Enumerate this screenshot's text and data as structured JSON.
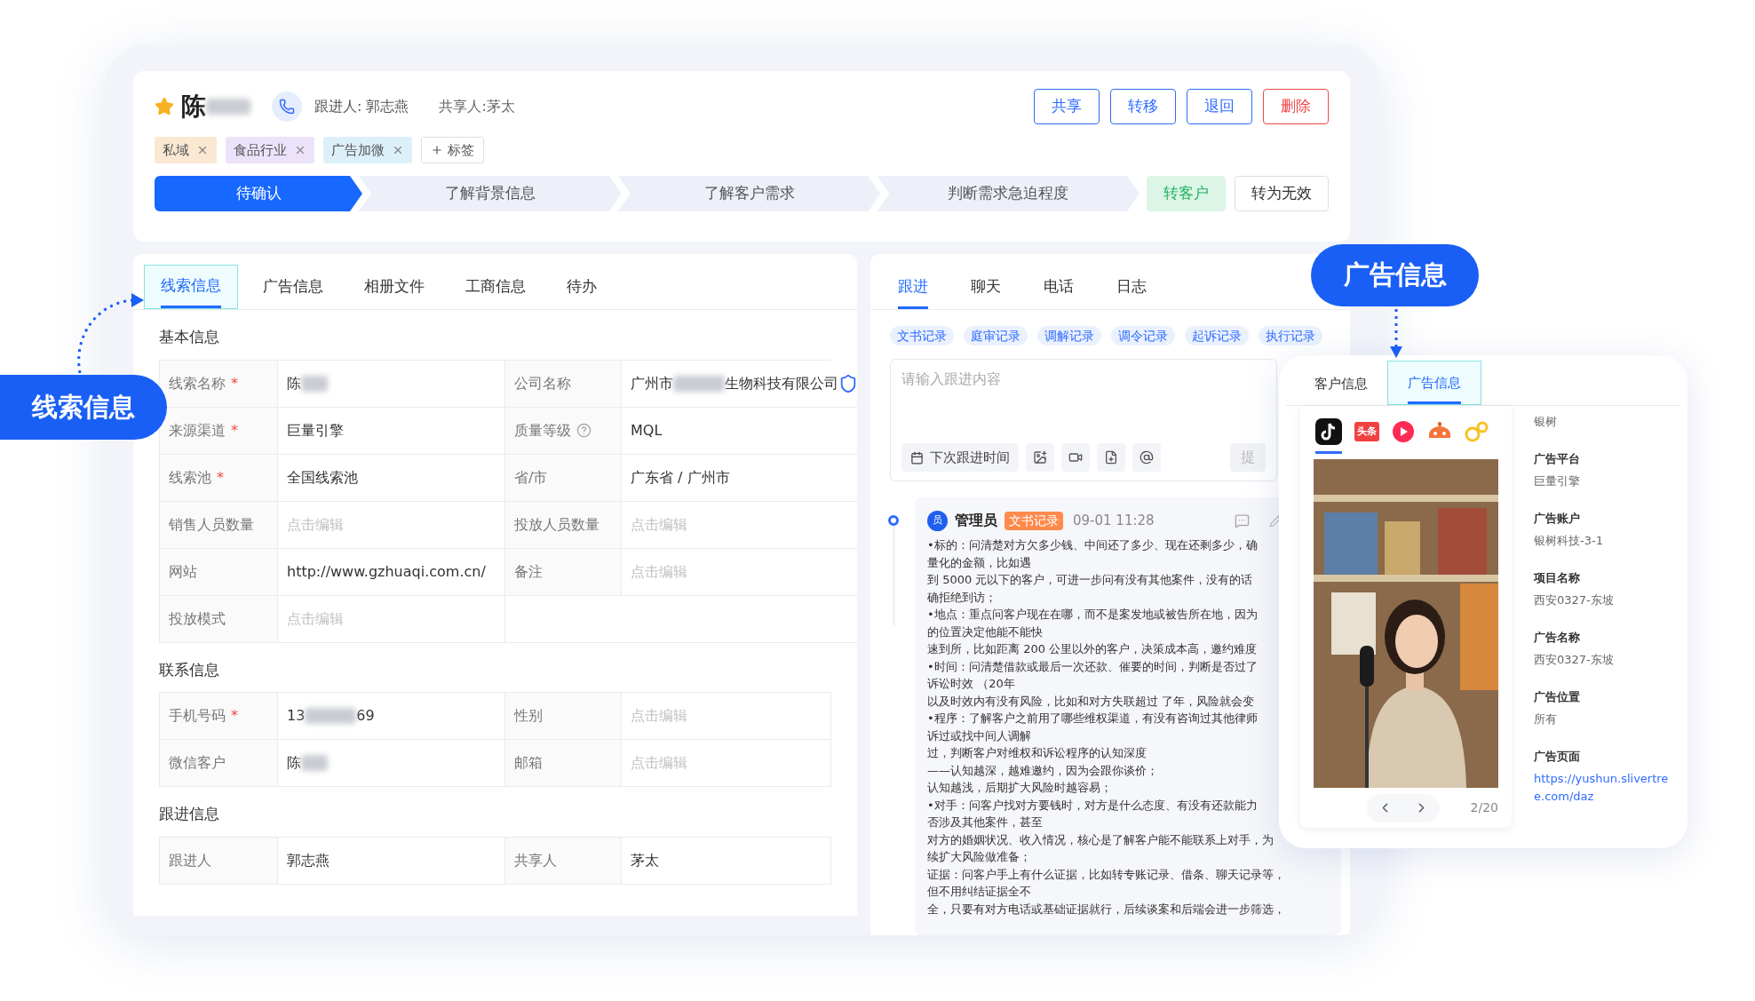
{
  "header": {
    "starred": true,
    "name": "陈",
    "name_redacted": true,
    "follower": "跟进人: 郭志燕",
    "sharer": "共享人:茅太",
    "actions": [
      {
        "label": "共享",
        "kind": "primary"
      },
      {
        "label": "转移",
        "kind": "primary"
      },
      {
        "label": "退回",
        "kind": "primary"
      },
      {
        "label": "删除",
        "kind": "danger"
      }
    ],
    "tags": [
      {
        "label": "私域",
        "color": "#fbe8d3"
      },
      {
        "label": "食品行业",
        "color": "#ece3fb"
      },
      {
        "label": "广告加微",
        "color": "#dcf0fa"
      }
    ],
    "add_tag": "标签",
    "stages": [
      {
        "label": "待确认",
        "selected": true
      },
      {
        "label": "了解背景信息",
        "selected": false
      },
      {
        "label": "了解客户需求",
        "selected": false
      },
      {
        "label": "判断需求急迫程度",
        "selected": false
      }
    ],
    "stage_actions": [
      {
        "label": "转客户",
        "kind": "success"
      },
      {
        "label": "转为无效",
        "kind": "plain"
      }
    ]
  },
  "lead_panel": {
    "tabs": [
      {
        "label": "线索信息",
        "selected": true
      },
      {
        "label": "广告信息",
        "selected": false
      },
      {
        "label": "相册文件",
        "selected": false
      },
      {
        "label": "工商信息",
        "selected": false
      },
      {
        "label": "待办",
        "selected": false
      }
    ],
    "sections": [
      {
        "title": "基本信息",
        "rows": [
          [
            {
              "label": "线索名称",
              "mark": "*",
              "value_parts": [
                "陈"
              ],
              "redacted": true
            },
            {
              "label": "公司名称",
              "value_parts": [
                "广州市",
                "生物科技有限公司"
              ],
              "redacted": true,
              "verified": true
            }
          ],
          [
            {
              "label": "来源渠道",
              "mark": "*",
              "value_parts": [
                "巨量引擎"
              ]
            },
            {
              "label": "质量等级",
              "help": true,
              "value_parts": [
                "MQL"
              ]
            }
          ],
          [
            {
              "label": "线索池",
              "mark": "*",
              "value_parts": [
                "全国线索池"
              ]
            },
            {
              "label": "省/市",
              "value_parts": [
                "广东省 / 广州市"
              ]
            }
          ],
          [
            {
              "label": "销售人员数量",
              "placeholder": "点击编辑"
            },
            {
              "label": "投放人员数量",
              "placeholder": "点击编辑"
            }
          ],
          [
            {
              "label": "网站",
              "value_parts": [
                "http://www.gzhuaqi.com.cn/"
              ]
            },
            {
              "label": "备注",
              "placeholder": "点击编辑"
            }
          ],
          [
            {
              "label": "投放模式",
              "placeholder": "点击编辑"
            }
          ]
        ]
      },
      {
        "title": "联系信息",
        "rows": [
          [
            {
              "label": "手机号码",
              "mark": "*",
              "value_parts": [
                "13",
                "69"
              ],
              "redacted": true
            },
            {
              "label": "性别",
              "placeholder": "点击编辑"
            }
          ],
          [
            {
              "label": "微信客户",
              "value_parts": [
                "陈"
              ],
              "redacted": true
            },
            {
              "label": "邮箱",
              "placeholder": "点击编辑"
            }
          ]
        ]
      },
      {
        "title": "跟进信息",
        "rows": [
          [
            {
              "label": "跟进人",
              "value_parts": [
                "郭志燕"
              ]
            },
            {
              "label": "共享人",
              "value_parts": [
                "茅太"
              ]
            }
          ]
        ]
      }
    ]
  },
  "follow_panel": {
    "tabs": [
      {
        "label": "跟进",
        "selected": true
      },
      {
        "label": "聊天",
        "selected": false
      },
      {
        "label": "电话",
        "selected": false
      },
      {
        "label": "日志",
        "selected": false
      }
    ],
    "record_types": [
      "文书记录",
      "庭审记录",
      "调解记录",
      "调令记录",
      "起诉记录",
      "执行记录"
    ],
    "composer": {
      "placeholder": "请输入跟进内容",
      "schedule_label": "下次跟进时间",
      "submit": "提"
    },
    "entries": [
      {
        "avatar": "员",
        "author": "管理员",
        "tag": "文书记录",
        "time": "09-01 11:28",
        "lines": [
          "•标的：问清楚对方欠多少钱、中间还了多少、现在还剩多少，确",
          "量化的金额，比如遇",
          "到 5000 元以下的客户，可进一步问有没有其他案件，没有的话",
          "确拒绝到访；",
          "•地点：重点问客户现在在哪，而不是案发地或被告所在地，因为",
          "的位置决定他能不能快",
          "速到所，比如距离 200 公里以外的客户，决策成本高，邀约难度",
          "•时间：问清楚借款或最后一次还款、催要的时间，判断是否过了",
          "诉讼时效 （20年",
          "以及时效内有没有风险，比如和对方失联超过 了年，风险就会变",
          "•程序：了解客户之前用了哪些维权渠道，有没有咨询过其他律师",
          "诉过或找中间人调解",
          "过，判断客户对维权和诉讼程序的认知深度",
          "——认知越深，越难邀约，因为会跟你谈价；",
          "认知越浅，后期扩大风险时越容易；",
          "•对手：问客户找对方要钱时，对方是什么态度、有没有还款能力",
          "否涉及其他案件，甚至",
          "对方的婚姻状况、收入情况，核心是了解客户能不能联系上对手，为",
          "续扩大风险做准备；",
          "证据：问客户手上有什么证据，比如转专账记录、借条、聊天记录等，",
          "但不用纠结证据全不",
          "全，只要有对方电话或基础证据就行，后续谈案和后端会进一步筛选，"
        ]
      }
    ]
  },
  "ad_popup": {
    "tabs": [
      {
        "label": "客户信息",
        "selected": false
      },
      {
        "label": "广告信息",
        "selected": true
      }
    ],
    "platforms": [
      {
        "kind": "note",
        "selected": true
      },
      {
        "kind": "badge",
        "label": "头条",
        "selected": false
      },
      {
        "kind": "play",
        "selected": false
      },
      {
        "kind": "pot",
        "selected": false
      },
      {
        "kind": "bubbles",
        "selected": false
      }
    ],
    "pager": "2/20",
    "partial_value": "银树",
    "fields": [
      {
        "label": "广告平台",
        "value": "巨量引擎"
      },
      {
        "label": "广告账户",
        "value": "银树科技-3-1"
      },
      {
        "label": "项目名称",
        "value": "西安0327-东坡"
      },
      {
        "label": "广告名称",
        "value": "西安0327-东坡"
      },
      {
        "label": "广告位置",
        "value": "所有"
      },
      {
        "label": "广告页面",
        "value": "https://yushun.slivertree.com/daz",
        "kind": "link"
      }
    ]
  },
  "callouts": [
    {
      "label": "线索信息",
      "kind": "left"
    },
    {
      "label": "广告信息",
      "kind": "down"
    }
  ]
}
